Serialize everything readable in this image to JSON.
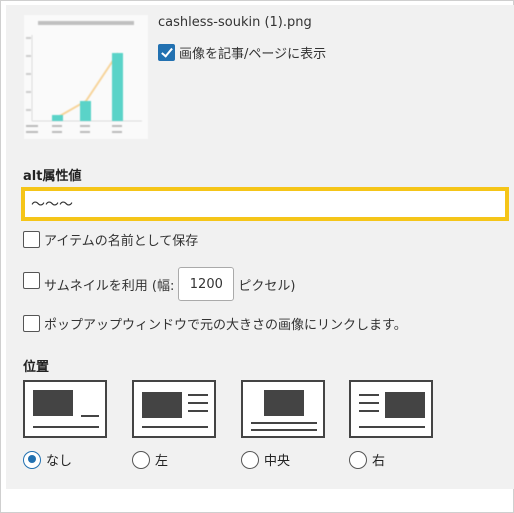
{
  "attachment": {
    "filename": "cashless-soukin (1).png",
    "show_on_page_label": "画像を記事/ページに表示",
    "show_on_page_checked": true
  },
  "alt": {
    "label": "alt属性値",
    "value": "〜〜〜"
  },
  "save_as_item_name_label": "アイテムの名前として保存",
  "thumbnail": {
    "label_before": "サムネイルを利用 (幅:",
    "width_value": "1200",
    "label_after": "ピクセル)"
  },
  "popup_link_label": "ポップアップウィンドウで元の大きさの画像にリンクします。",
  "position": {
    "label": "位置",
    "options": [
      {
        "label": "なし",
        "selected": true
      },
      {
        "label": "左",
        "selected": false
      },
      {
        "label": "中央",
        "selected": false
      },
      {
        "label": "右",
        "selected": false
      }
    ]
  },
  "colors": {
    "accent": "#2271b1",
    "focus_border": "#f5c518",
    "chart_bar": "#5ad3c8",
    "chart_line": "#f7d49a"
  }
}
